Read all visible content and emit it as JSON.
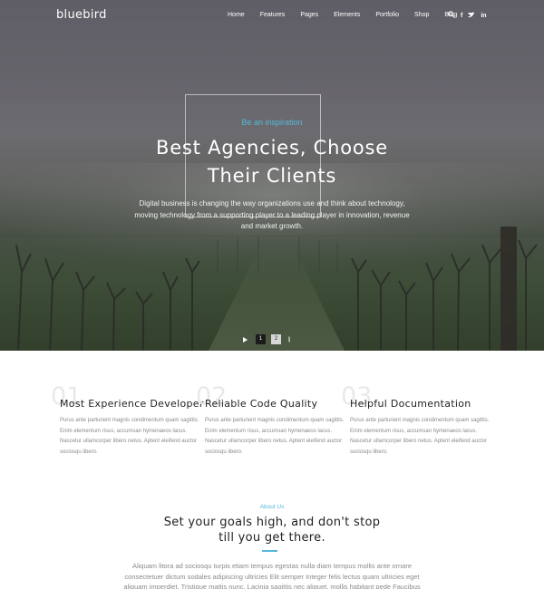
{
  "nav": {
    "logo": "bluebird",
    "items": [
      "Home",
      "Features",
      "Pages",
      "Elements",
      "Portfolio",
      "Shop",
      "Blog"
    ],
    "icons": [
      "search-icon",
      "facebook-icon",
      "twitter-icon",
      "linkedin-icon"
    ]
  },
  "hero": {
    "eyebrow": "Be an inspiration",
    "headline_line1": "Best Agencies, Choose",
    "headline_line2": "Their Clients",
    "subtext": "Digital business is changing the way organizations use and think about technology, moving technology from a supporting player to a leading player in innovation, revenue and market growth.",
    "slides": [
      "1",
      "2"
    ],
    "active_slide": "1"
  },
  "features": [
    {
      "number": "01",
      "title": "Most Experience Developer",
      "text": "Purus ante parturient magnis condimentum quam sagittis. Enim elementum risus, accumsan hymenaeos lacus. Nascetur ullamcorper libero netus. Aptent eleifend auctor sociosqu libero."
    },
    {
      "number": "02",
      "title": "Reliable Code Quality",
      "text": "Purus ante parturient magnis condimentum quam sagittis. Enim elementum risus, accumsan hymenaeos lacus. Nascetur ullamcorper libero netus. Aptent eleifend auctor sociosqu libero."
    },
    {
      "number": "03",
      "title": "Helpful Documentation",
      "text": "Purus ante parturient magnis condimentum quam sagittis. Enim elementum risus, accumsan hymenaeos lacus. Nascetur ullamcorper libero netus. Aptent eleifend auctor sociosqu libero."
    }
  ],
  "about": {
    "eyebrow": "About Us",
    "title_line1": "Set your goals high, and don't stop",
    "title_line2": "till you get there.",
    "text": "Aliquam litora ad sociosqu turpis etiam tempus egestas nulla diam tempus mollis ante ornare consectetuer dictum sodales adipiscing ultricies Elit semper Integer felis lectus quam ultricies eget aliquam imperdiet. Tristique mattis nunc. Lacinia sagittis nec aliquet, mollis habitant pede Faucibus"
  },
  "colors": {
    "accent": "#53b9d9",
    "dark": "#222222",
    "muted": "#8a8a8a"
  }
}
